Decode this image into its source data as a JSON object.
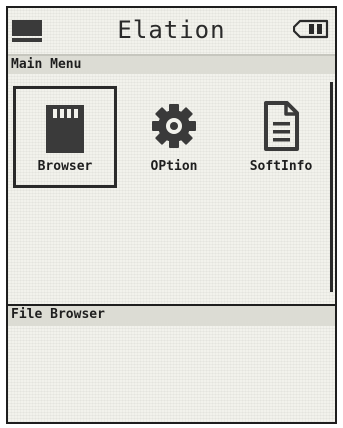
{
  "header": {
    "title": "Elation"
  },
  "main_menu": {
    "section_label": "Main Menu",
    "items": [
      {
        "label": "Browser",
        "icon": "sd-card-icon",
        "selected": true
      },
      {
        "label": "OPtion",
        "icon": "gear-icon",
        "selected": false
      },
      {
        "label": "SoftInfo",
        "icon": "document-icon",
        "selected": false
      }
    ]
  },
  "description": {
    "section_label": "File Browser"
  }
}
